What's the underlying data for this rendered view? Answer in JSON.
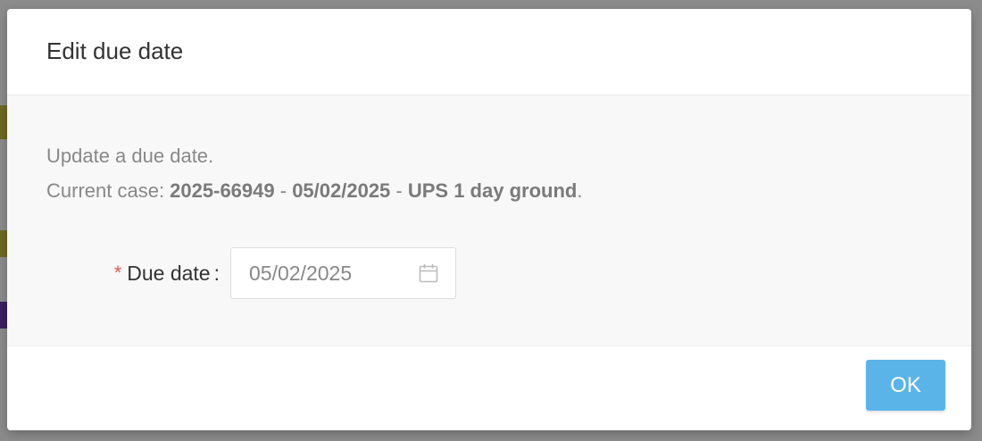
{
  "dialog": {
    "title": "Edit due date",
    "description_line1": "Update a due date.",
    "current_case_prefix": "Current case: ",
    "current_case_id": "2025-66949",
    "separator1": " - ",
    "current_case_date": "05/02/2025",
    "separator2": " - ",
    "current_case_shipping": "UPS 1 day ground",
    "current_case_suffix": ".",
    "form": {
      "required_marker": "*",
      "due_date_label": "Due date",
      "label_colon": ":",
      "due_date_value": "05/02/2025",
      "calendar_icon": "calendar-icon"
    },
    "ok_label": "OK"
  },
  "colors": {
    "accent_button": "#5bb4e8",
    "required": "#e85656"
  }
}
